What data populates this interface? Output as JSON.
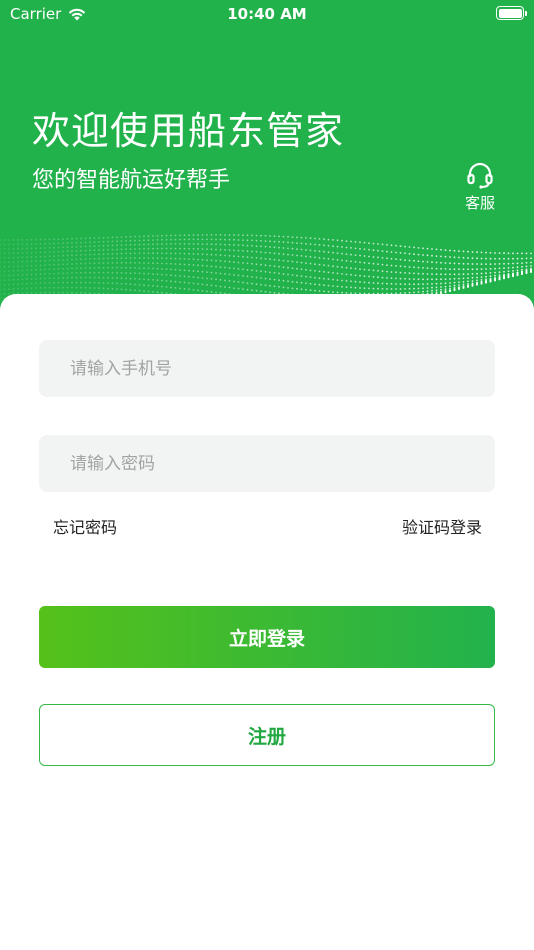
{
  "status_bar": {
    "carrier": "Carrier",
    "time": "10:40 AM"
  },
  "header": {
    "title": "欢迎使用船东管家",
    "subtitle": "您的智能航运好帮手",
    "service_label": "客服",
    "service_icon": "headset-icon",
    "bg_color": "#22b24c"
  },
  "form": {
    "phone_placeholder": "请输入手机号",
    "phone_value": "",
    "password_placeholder": "请输入密码",
    "password_value": "",
    "forgot_password": "忘记密码",
    "sms_login": "验证码登录",
    "login_button": "立即登录",
    "register_button": "注册"
  },
  "colors": {
    "primary": "#22b24c",
    "gradient_start": "#55c11a",
    "input_bg": "#f2f4f3"
  }
}
